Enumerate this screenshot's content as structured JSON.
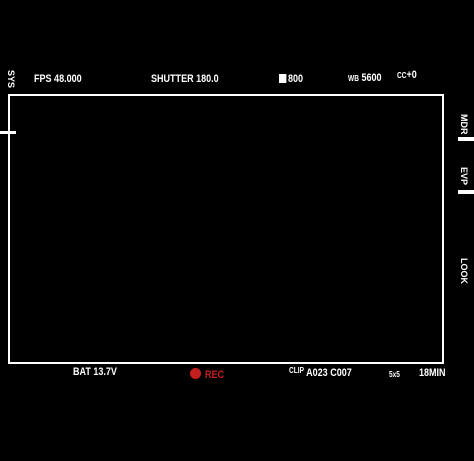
{
  "side_labels": {
    "sys": "SYS",
    "mdr": "MDR",
    "evp": "EVP",
    "look": "LOOK"
  },
  "top_bar": {
    "fps": "FPS 48.000",
    "shutter": "SHUTTER 180.0",
    "iso": "800",
    "wb_prefix": "WB",
    "wb_value": "5600",
    "cc_prefix": "CC",
    "cc_value": "+0"
  },
  "bottom_bar": {
    "battery": "BAT 13.7V",
    "rec": "REC",
    "clip_prefix": "CLIP",
    "clip_value": "A023 C007",
    "format": "5x5",
    "remaining": "18MIN"
  },
  "colors": {
    "background": "#000000",
    "foreground": "#ffffff",
    "record": "#c41e1e"
  }
}
